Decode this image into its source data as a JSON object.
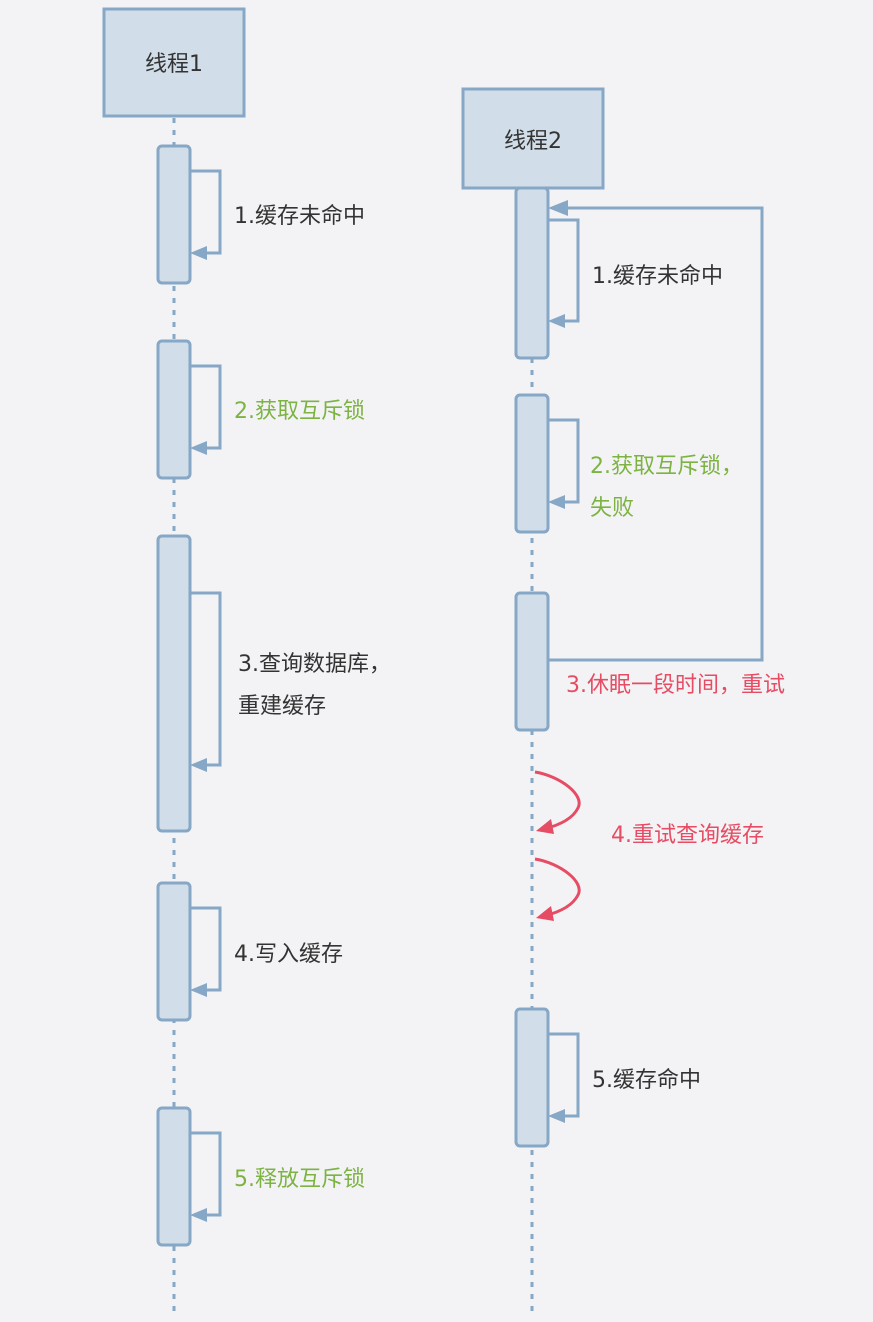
{
  "colors": {
    "background": "#f3f3f6",
    "box_fill": "#d1dde8",
    "box_stroke": "#86a7c5",
    "text_default": "#333333",
    "text_lock": "#7cb342",
    "text_retry": "#e64c63"
  },
  "participants": [
    {
      "name": "线程1"
    },
    {
      "name": "线程2"
    }
  ],
  "thread1_steps": [
    {
      "lines": [
        "1.缓存未命中"
      ],
      "color": "#333333"
    },
    {
      "lines": [
        "2.获取互斥锁"
      ],
      "color": "#7cb342"
    },
    {
      "lines": [
        "3.查询数据库，",
        "重建缓存"
      ],
      "color": "#333333"
    },
    {
      "lines": [
        "4.写入缓存"
      ],
      "color": "#333333"
    },
    {
      "lines": [
        "5.释放互斥锁"
      ],
      "color": "#7cb342"
    }
  ],
  "thread2_steps": [
    {
      "lines": [
        "1.缓存未命中"
      ],
      "color": "#333333"
    },
    {
      "lines": [
        "2.获取互斥锁，",
        "失败"
      ],
      "color": "#7cb342"
    },
    {
      "lines": [
        "3.休眠一段时间，重试"
      ],
      "color": "#e64c63"
    },
    {
      "lines": [
        "4.重试查询缓存"
      ],
      "color": "#e64c63"
    },
    {
      "lines": [
        "5.缓存命中"
      ],
      "color": "#333333"
    }
  ]
}
